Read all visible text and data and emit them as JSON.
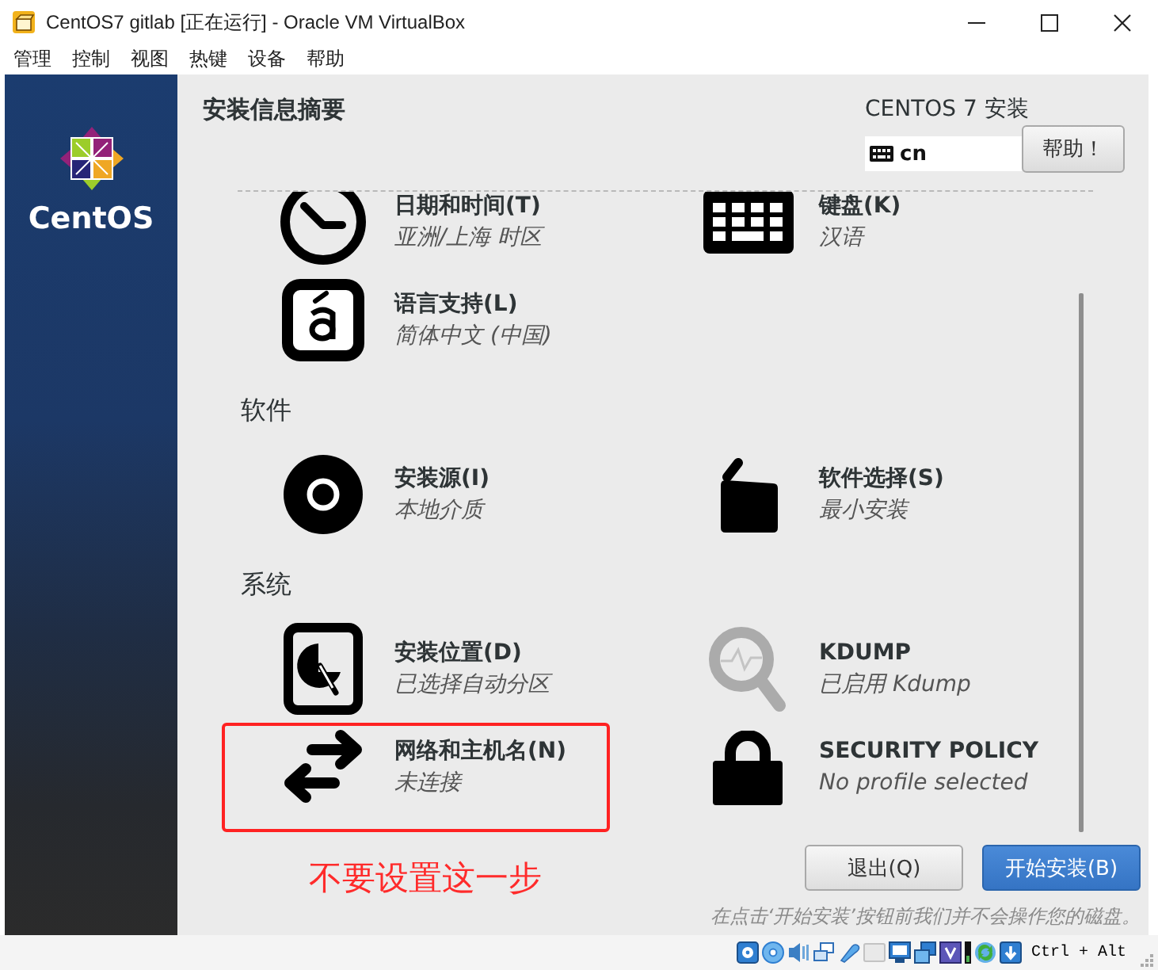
{
  "window": {
    "title": "CentOS7 gitlab [正在运行] - Oracle VM VirtualBox"
  },
  "menu_bar": [
    "管理",
    "控制",
    "视图",
    "热键",
    "设备",
    "帮助"
  ],
  "installer": {
    "logo_text": "CentOS",
    "title": "安装信息摘要",
    "product": "CENTOS 7 安装",
    "keyboard_layout": "cn",
    "help_button": "帮助！",
    "sections": [
      {
        "items": [
          {
            "kind": "clock",
            "title": "日期和时间(T)",
            "status": "亚洲/上海 时区",
            "highlighted": false
          },
          {
            "kind": "keyboard",
            "title": "键盘(K)",
            "status": "汉语",
            "highlighted": false
          },
          {
            "kind": "language",
            "title": "语言支持(L)",
            "status": "简体中文 (中国)",
            "highlighted": false
          }
        ]
      },
      {
        "heading": "软件",
        "items": [
          {
            "kind": "disc",
            "title": "安装源(I)",
            "status": "本地介质",
            "highlighted": false
          },
          {
            "kind": "package",
            "title": "软件选择(S)",
            "status": "最小安装",
            "highlighted": false
          }
        ]
      },
      {
        "heading": "系统",
        "items": [
          {
            "kind": "harddrive",
            "title": "安装位置(D)",
            "status": "已选择自动分区",
            "highlighted": false
          },
          {
            "kind": "kdump",
            "title": "KDUMP",
            "status": "已启用 Kdump",
            "highlighted": false
          },
          {
            "kind": "network",
            "title": "网络和主机名(N)",
            "status": "未连接",
            "highlighted": true
          },
          {
            "kind": "lock",
            "title": "SECURITY POLICY",
            "status": "No profile selected",
            "highlighted": false
          }
        ]
      }
    ],
    "buttons": [
      {
        "label": "退出(Q)",
        "kind": "secondary"
      },
      {
        "label": "开始安装(B)",
        "kind": "primary"
      }
    ],
    "disk_note": "在点击‘开始安装’按钮前我们并不会操作您的磁盘。"
  },
  "annotation": {
    "note": "不要设置这一步"
  },
  "status_bar": {
    "host_key": "Ctrl + Alt"
  }
}
